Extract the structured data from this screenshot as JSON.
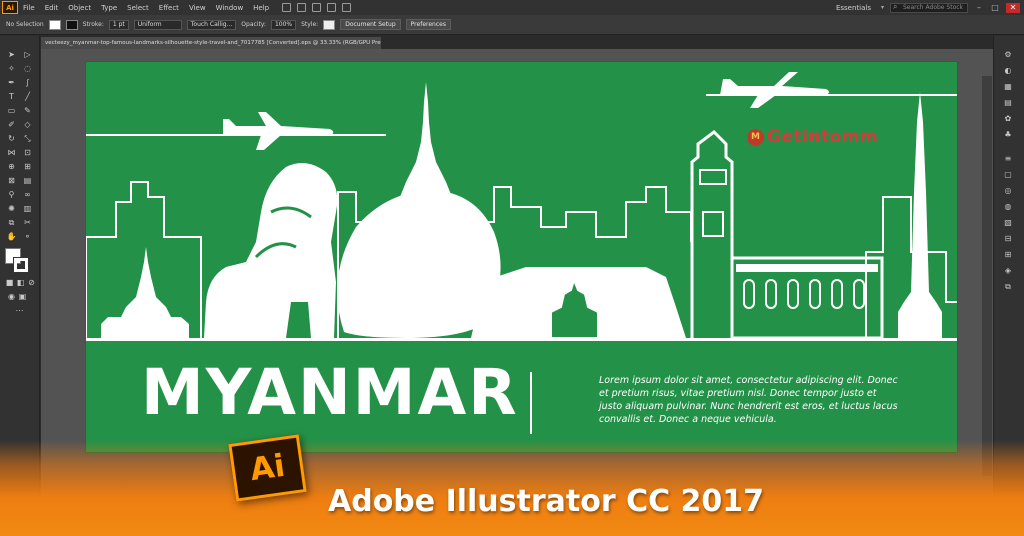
{
  "app": {
    "logo_text": "Ai",
    "menu": [
      "File",
      "Edit",
      "Object",
      "Type",
      "Select",
      "Effect",
      "View",
      "Window",
      "Help"
    ],
    "workspace": "Essentials",
    "stock_search_placeholder": "Search Adobe Stock"
  },
  "control_bar": {
    "selection": "No Selection",
    "stroke_label": "Stroke:",
    "stroke_weight": "1 pt",
    "stroke_profile": "Uniform",
    "brush": "Touch Callig...",
    "opacity_label": "Opacity:",
    "opacity_value": "100%",
    "style_label": "Style:",
    "document_setup": "Document Setup",
    "preferences": "Preferences"
  },
  "document": {
    "tab_title": "vecteezy_myanmar-top-famous-landmarks-silhouette-style-travel-and_7017785 [Converted].eps @ 33.33% (RGB/GPU Preview)"
  },
  "artwork": {
    "title": "MYANMAR",
    "body": "Lorem ipsum dolor sit amet, consectetur adipiscing elit. Donec et pretium risus, vitae pretium nisl. Donec tempor justo et justo aliquam pulvinar. Nunc hendrerit est eros, et luctus lacus convallis et. Donec a neque vehicula.",
    "background_color": "#249148",
    "silhouette_color": "#ffffff"
  },
  "watermark": {
    "text": "Getintomm",
    "color": "#d63b3b"
  },
  "banner": {
    "logo_text": "Ai",
    "title": "Adobe Illustrator CC 2017",
    "accent": "#ff9a00"
  }
}
